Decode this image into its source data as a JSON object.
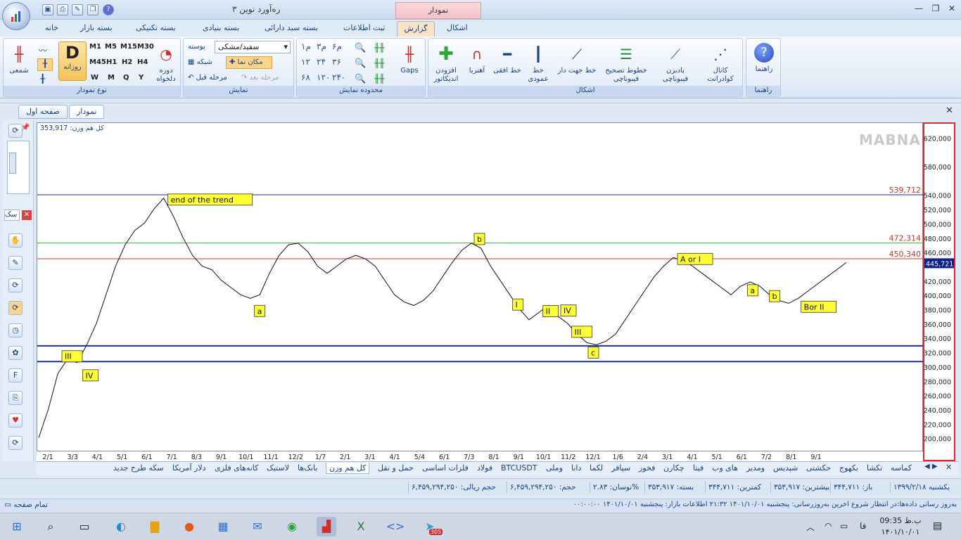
{
  "app": {
    "window_title": "ره‌آورد نوین ۳",
    "context_tab_head": "نمودار"
  },
  "tabs": [
    "اشکال",
    "گزارش",
    "ثبت اطلاعات",
    "بسته سبد دارائی",
    "بسته بنیادی",
    "بسته تکنیکی",
    "بسته بازار",
    "خانه"
  ],
  "ribbon": {
    "groups": {
      "guide": "راهنما",
      "shapes": "اشکال",
      "range": "محدوده نمایش",
      "display": "نمایش",
      "chart_type": "نوع نمودار"
    },
    "guide_btn": "راهنما",
    "shape_btns": [
      "کانال کوادرانت",
      "بادبزن فیبوناچی",
      "خطوط تصحیح فیبوناچی",
      "خط جهت دار",
      "خط عمودی",
      "خط افقی",
      "آهنربا",
      "افزودن اندیکاتور"
    ],
    "gaps": "Gaps",
    "theme_label": "پوسته",
    "theme_value": "سفید/مشکی",
    "cursor_btn": "مکان نما",
    "grid_btn": "شبکه",
    "prev_step": "مرحله قبل",
    "next_step": "مرحله بعد",
    "period": "دوره دلخواه",
    "daily": "روزانه",
    "candle": "شمعی",
    "timeframes": [
      "M1",
      "M5",
      "M15",
      "M30",
      "M45",
      "H1",
      "H2",
      "H4",
      "W",
      "M",
      "Q",
      "Y"
    ],
    "range_labels": [
      "۱م",
      "۳م",
      "۶م",
      "۱۲",
      "۲۴",
      "۳۶",
      "۶۸",
      "۱۲۰",
      "۲۴۰"
    ]
  },
  "doc_tabs": {
    "first": "صفحه اول",
    "chart": "نمودار"
  },
  "chart_data": {
    "type": "line",
    "title": "کل هم وزن",
    "readout_label": "کل هم وزن: 353,917",
    "watermark": "MABNA",
    "current_value": "445,721.4",
    "yticks": [
      "620,000",
      "580,000",
      "540,000",
      "520,000",
      "500,000",
      "480,000",
      "460,000",
      "420,000",
      "400,000",
      "380,000",
      "360,000",
      "340,000",
      "320,000",
      "300,000",
      "280,000",
      "260,000",
      "240,000",
      "220,000",
      "200,000"
    ],
    "ytick_values": [
      620000,
      580000,
      540000,
      520000,
      500000,
      480000,
      460000,
      420000,
      400000,
      380000,
      360000,
      340000,
      320000,
      300000,
      280000,
      260000,
      240000,
      220000,
      200000
    ],
    "ylim": [
      180000,
      640000
    ],
    "xticks": [
      "2/1",
      "3/3",
      "4/1",
      "5/1",
      "6/1",
      "7/1",
      "8/3",
      "9/1",
      "10/1",
      "11/1",
      "12/2",
      "1/7",
      "2/1",
      "3/1",
      "4/1",
      "5/4",
      "6/1",
      "7/3",
      "8/1",
      "9/1",
      "10/1",
      "11/2",
      "12/1",
      "1/6",
      "2/4",
      "3/1",
      "4/1",
      "5/1",
      "6/1",
      "7/2",
      "8/1",
      "9/1"
    ],
    "hlines": [
      {
        "label": "539,712",
        "value": 539712,
        "color": "#1f2a9c"
      },
      {
        "label": "472,314",
        "value": 472314,
        "color": "#2fb52f"
      },
      {
        "label": "450,340",
        "value": 450340,
        "color": "#d13b2b"
      },
      {
        "value": 328500,
        "color": "#1f2fb0"
      },
      {
        "value": 306500,
        "color": "#1f2fb0"
      }
    ],
    "series": [
      {
        "values": [
          200000,
          240000,
          290000,
          310000,
          305000,
          330000,
          360000,
          400000,
          440000,
          470000,
          490000,
          500000,
          520000,
          535000,
          510000,
          480000,
          455000,
          440000,
          435000,
          420000,
          410000,
          400000,
          395000,
          400000,
          430000,
          455000,
          470000,
          472000,
          460000,
          440000,
          430000,
          440000,
          450000,
          455000,
          450000,
          440000,
          420000,
          400000,
          390000,
          385000,
          392000,
          405000,
          425000,
          445000,
          462000,
          472000,
          465000,
          440000,
          420000,
          400000,
          380000,
          365000,
          375000,
          385000,
          370000,
          360000,
          345000,
          333000,
          330000,
          335000,
          345000,
          365000,
          385000,
          405000,
          425000,
          440000,
          452000,
          448000,
          440000,
          430000,
          420000,
          410000,
          400000,
          412000,
          418000,
          412000,
          400000,
          392000,
          388000,
          395000,
          405000,
          415000,
          425000,
          435000,
          445000
        ]
      }
    ],
    "annotations": [
      "end of the trend",
      "III",
      "IV",
      "a",
      "b",
      "I",
      "II",
      "III",
      "IV",
      "c",
      "A or I",
      "a",
      "b",
      "Bor II"
    ]
  },
  "sheets": [
    "کماسه",
    "تکشا",
    "بکهوج",
    "حکشتی",
    "شپدیس",
    "ومدیر",
    "های وب",
    "فیتا",
    "چکارن",
    "فخوز",
    "سپافر",
    "لکما",
    "دانا",
    "وملی",
    "BTCUSDT",
    "فولاد",
    "فلزات اساسی",
    "حمل و نقل",
    "کل هم وزن",
    "بانک‌ها",
    "لاستیک",
    "کانه‌های فلزی",
    "دلار آمریکا",
    "سکه طرح جدید"
  ],
  "active_sheet": "کل هم وزن",
  "infobar": [
    "یکشنبه ۱۳۹۹/۲/۱۸",
    "باز: ۳۴۴,۷۱۱",
    "بیشترین: ۳۵۳,۹۱۷",
    "کمترین: ۳۴۴,۷۱۱",
    "بسته: ۳۵۳,۹۱۷",
    "نوسان: ۲.۸۳%",
    "حجم: ۶,۴۵۹,۲۹۴,۲۵۰",
    "حجم ریالی: ۶,۴۵۹,۲۹۴,۲۵۰"
  ],
  "status": {
    "left": "تمام صفحه",
    "right": "به‌روز رسانی داده‌ها:در انتظار شروع   آخرین به‌روزرسانی: پنجشنبه ۱۴۰۱/۱۰/۰۱ ۲۱:۳۲   اطلاعات بازار: پنجشنبه ۱۴۰۱/۱۰/۰۱ ۰۰:۰۰:۰۰"
  },
  "taskbar": {
    "time": "09:35 ب.ظ",
    "date": "۱۴۰۱/۱۰/۰۱",
    "lang": "فا",
    "badge": "305"
  }
}
